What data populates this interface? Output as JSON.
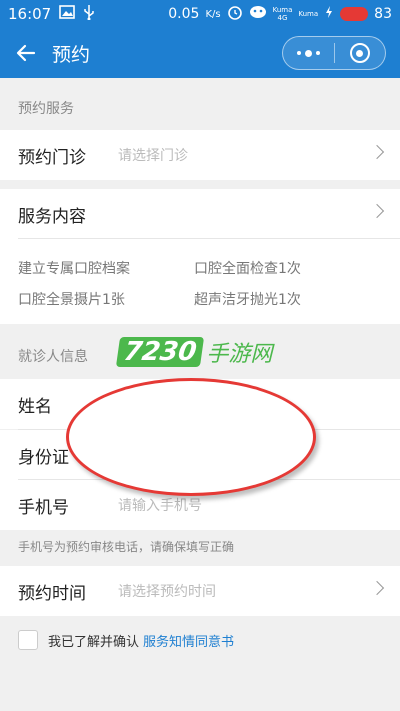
{
  "status_bar": {
    "time": "16:07",
    "net_speed": "0.05",
    "net_unit": "K/s",
    "carrier1": "Kuma",
    "carrier2": "Kuma",
    "sig1": "4G",
    "battery": "83"
  },
  "nav": {
    "title": "预约"
  },
  "sections": {
    "service_label": "预约服务",
    "patient_label": "就诊人信息"
  },
  "clinic": {
    "label": "预约门诊",
    "placeholder": "请选择门诊"
  },
  "service_content": {
    "label": "服务内容",
    "items": [
      "建立专属口腔档案",
      "口腔全面检查1次",
      "口腔全景摄片1张",
      "超声洁牙抛光1次"
    ]
  },
  "watermark": {
    "number": "7230",
    "text": "手游网"
  },
  "patient": {
    "name_label": "姓名",
    "id_label": "身份证",
    "phone_label": "手机号",
    "phone_placeholder": "请输入手机号",
    "hint": "手机号为预约审核电话，请确保填写正确"
  },
  "time": {
    "label": "预约时间",
    "placeholder": "请选择预约时间"
  },
  "agreement": {
    "text": "我已了解并确认",
    "link": "服务知情同意书"
  }
}
